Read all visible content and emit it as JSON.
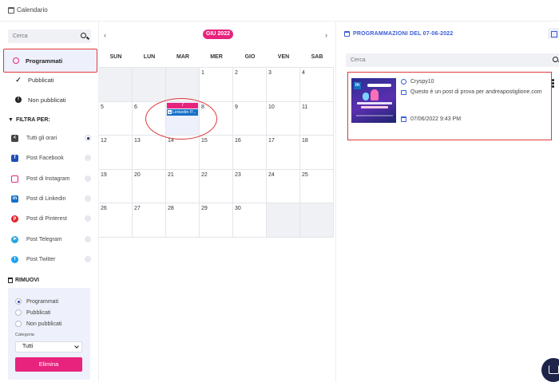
{
  "app": {
    "title": "Calendario"
  },
  "sidebar": {
    "search_placeholder": "Cerca",
    "nav": [
      {
        "label": "Programmati",
        "icon": "ring-icon",
        "active": true
      },
      {
        "label": "Pubblicati",
        "icon": "double-check-icon",
        "active": false
      },
      {
        "label": "Non pubblicati",
        "icon": "exclamation-icon",
        "active": false
      }
    ],
    "filter_title": "FILTRA PER:",
    "filters": [
      {
        "label": "Tutti gli orari",
        "icon": "share-icon",
        "color": "#444444",
        "selected": true
      },
      {
        "label": "Post Facebook",
        "icon": "facebook-icon",
        "color": "#1f4fb3",
        "selected": false
      },
      {
        "label": "Post di Instagram",
        "icon": "instagram-icon",
        "color": "#e8237d",
        "selected": false
      },
      {
        "label": "Post di Linkedin",
        "icon": "linkedin-icon",
        "color": "#1670c8",
        "selected": false
      },
      {
        "label": "Post di Pinterest",
        "icon": "pinterest-icon",
        "color": "#e0242c",
        "selected": false
      },
      {
        "label": "Post Telegram",
        "icon": "telegram-icon",
        "color": "#2aa3e0",
        "selected": false
      },
      {
        "label": "Post Twitter",
        "icon": "twitter-icon",
        "color": "#1da1f2",
        "selected": false
      }
    ],
    "remove_title": "RIMUOVI",
    "remove_options": [
      {
        "label": "Programmati",
        "selected": true
      },
      {
        "label": "Pubblicati",
        "selected": false
      },
      {
        "label": "Non pubblicati",
        "selected": false
      }
    ],
    "category_label": "Categoria",
    "category_value": "Tutti",
    "delete_button": "Elimina"
  },
  "calendar": {
    "month_label": "GIU 2022",
    "prev": "‹",
    "next": "›",
    "weekdays": [
      "SUN",
      "LUN",
      "MAR",
      "MER",
      "GIO",
      "VEN",
      "SAB"
    ],
    "weeks": [
      [
        null,
        null,
        null,
        "1",
        "2",
        "3",
        "4"
      ],
      [
        "5",
        "6",
        "7",
        "8",
        "9",
        "10",
        "11"
      ],
      [
        "12",
        "13",
        "14",
        "15",
        "16",
        "17",
        "18"
      ],
      [
        "19",
        "20",
        "21",
        "22",
        "23",
        "24",
        "25"
      ],
      [
        "26",
        "27",
        "28",
        "29",
        "30",
        null,
        null
      ]
    ],
    "today": "7",
    "event": {
      "label": "Linkedin P...",
      "icon": "linkedin-icon"
    }
  },
  "right_panel": {
    "title": "PROGRAMMAZIONI DEL 07-06-2022",
    "search_placeholder": "Cerca",
    "post": {
      "user": "Cryspy10",
      "message": "Questo è un post di prova per andreapostiglione.com",
      "datetime": "07/06/2022 9:43 PM"
    }
  }
}
